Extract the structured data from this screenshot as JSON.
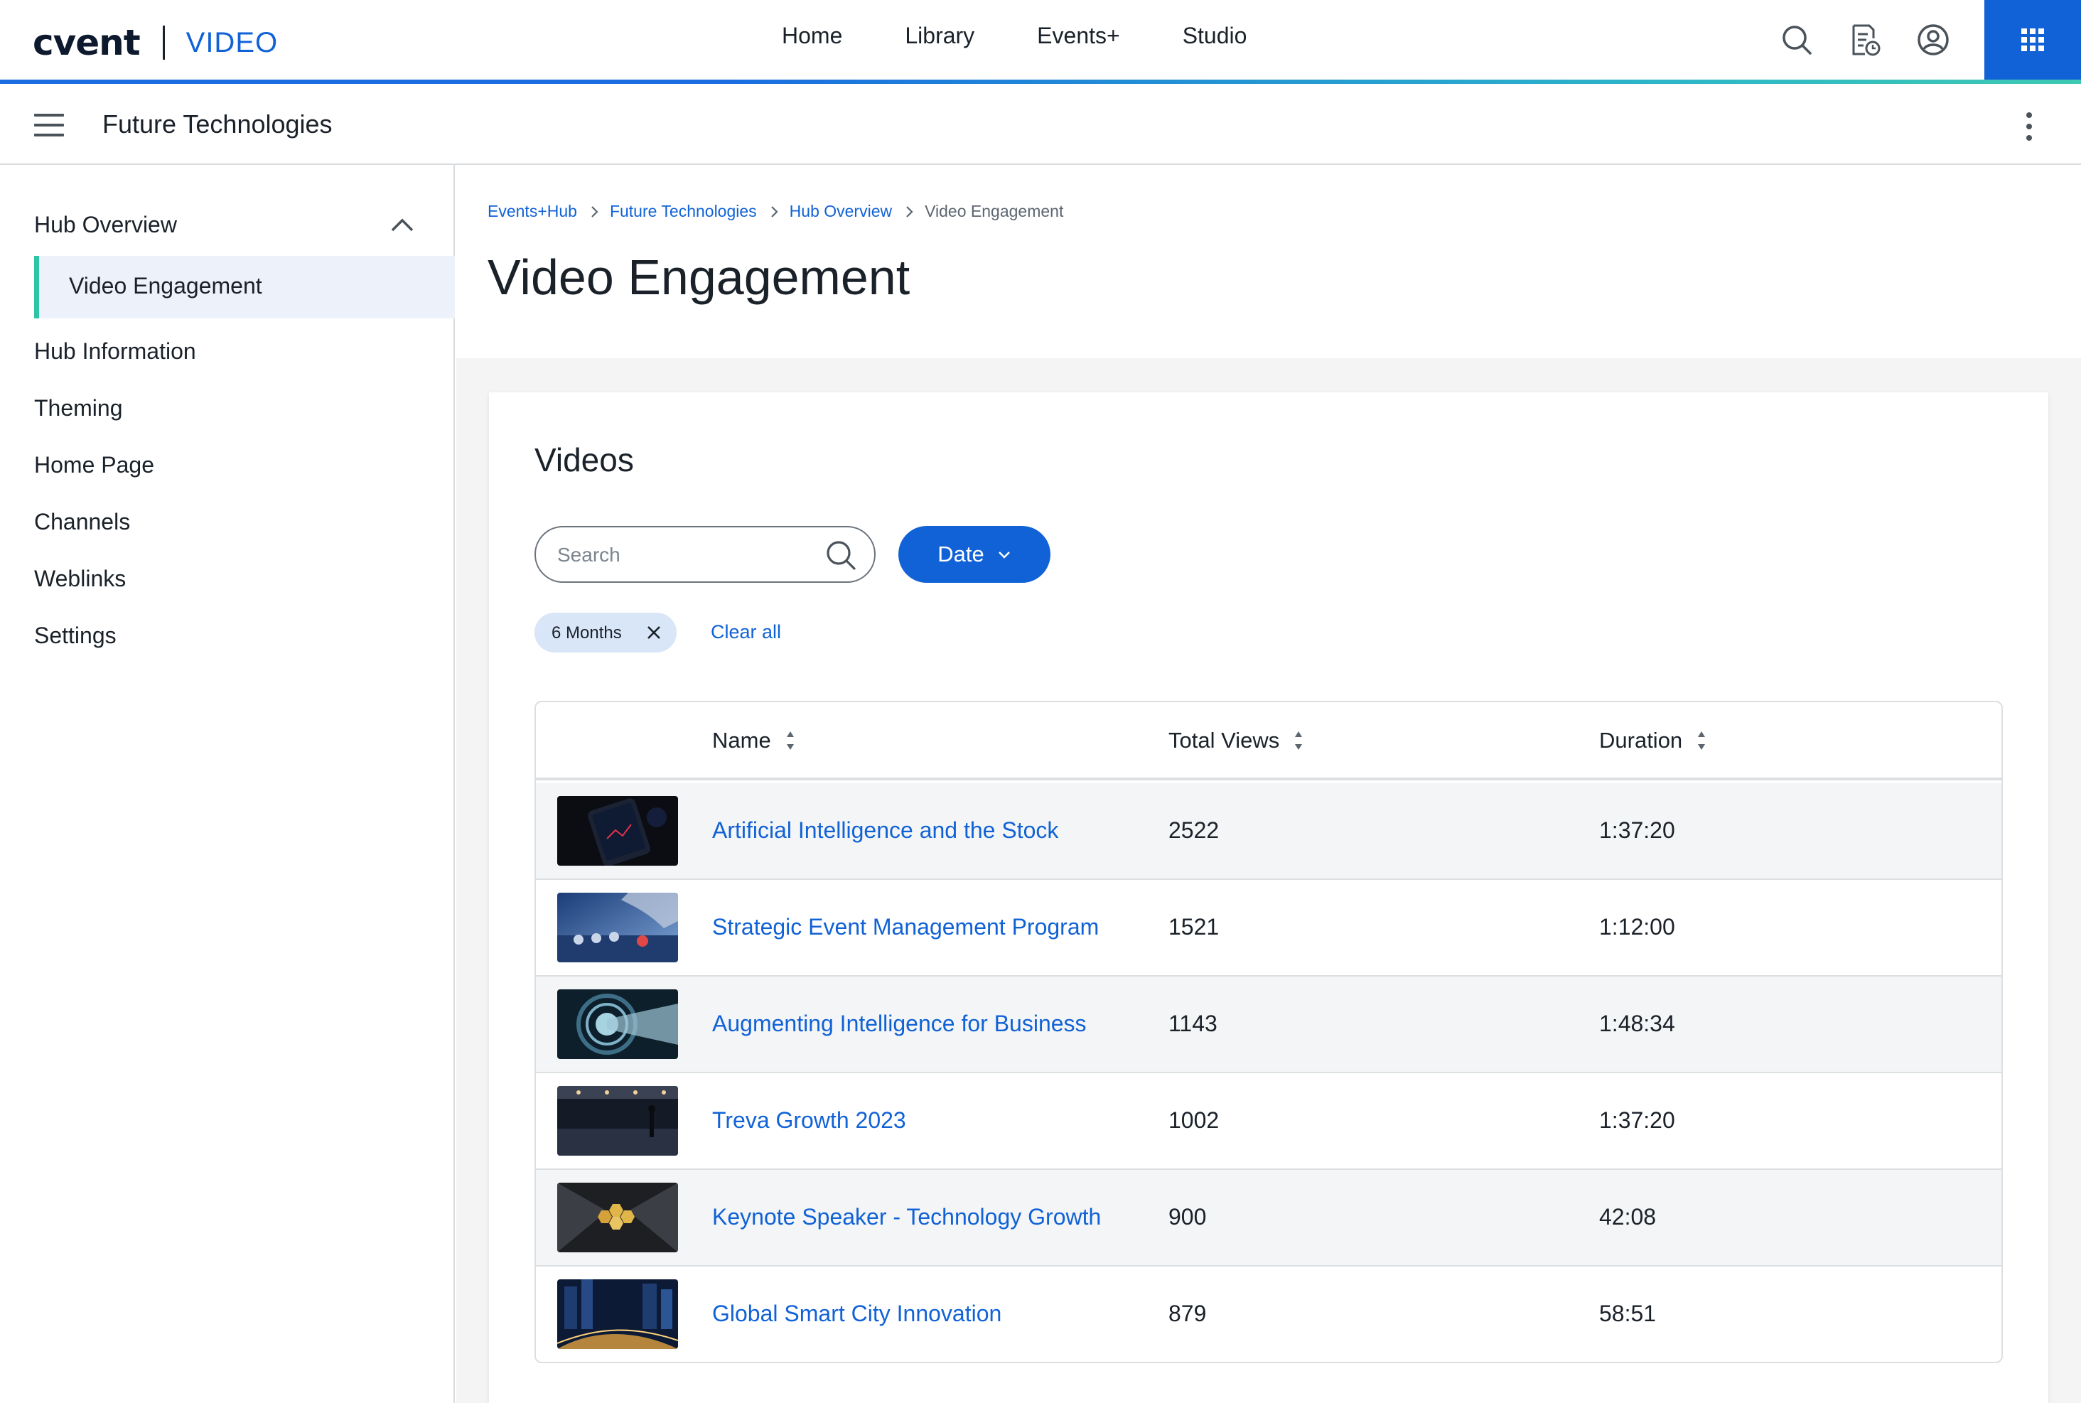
{
  "brand": {
    "logo": "cvent",
    "product": "VIDEO",
    "accent_color": "#1062d6",
    "teal_color": "#2ec4a6"
  },
  "topnav": {
    "items": [
      "Home",
      "Library",
      "Events+",
      "Studio"
    ]
  },
  "top_icons": [
    "search-icon",
    "scheduled-report-icon",
    "user-account-icon",
    "apps-grid-icon"
  ],
  "subheader": {
    "title": "Future Technologies"
  },
  "sidebar": {
    "group_label": "Hub Overview",
    "active_item": "Video Engagement",
    "items": [
      "Hub Information",
      "Theming",
      "Home Page",
      "Channels",
      "Weblinks",
      "Settings"
    ]
  },
  "breadcrumb": [
    "Events+Hub",
    "Future Technologies",
    "Hub Overview",
    "Video Engagement"
  ],
  "page": {
    "title": "Video Engagement"
  },
  "videos_card": {
    "title": "Videos",
    "search_placeholder": "Search",
    "date_button": "Date",
    "filter_chip": "6 Months",
    "clear_all": "Clear all"
  },
  "table": {
    "columns": [
      "Name",
      "Total Views",
      "Duration"
    ],
    "rows": [
      {
        "name": "Artificial Intelligence and the Stock",
        "views": "2522",
        "duration": "1:37:20"
      },
      {
        "name": "Strategic Event Management Program",
        "views": "1521",
        "duration": "1:12:00"
      },
      {
        "name": "Augmenting Intelligence for Business",
        "views": "1143",
        "duration": "1:48:34"
      },
      {
        "name": "Treva Growth 2023",
        "views": "1002",
        "duration": "1:37:20"
      },
      {
        "name": "Keynote Speaker  - Technology Growth",
        "views": "900",
        "duration": "42:08"
      },
      {
        "name": "Global Smart City Innovation",
        "views": "879",
        "duration": "58:51"
      }
    ]
  }
}
